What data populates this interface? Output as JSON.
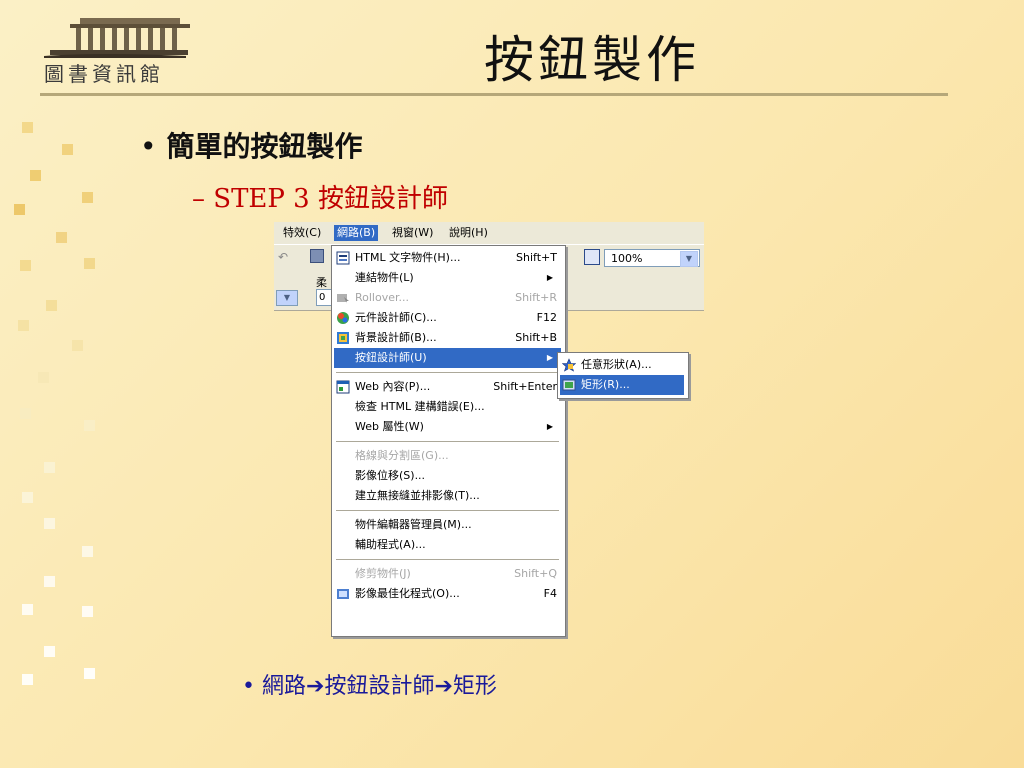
{
  "logo": {
    "caption": "圖書資訊館"
  },
  "slide": {
    "title": "按鈕製作",
    "bullet1": "簡單的按鈕製作",
    "bullet1_marker": "•",
    "bullet2": "– STEP  3  按鈕設計師",
    "bullet3_marker": "•",
    "bullet3_parts": [
      "網路",
      "按鈕設計師",
      "矩形"
    ],
    "arrow_glyph": "➔"
  },
  "app": {
    "menubar": [
      {
        "label": "特效(C)"
      },
      {
        "label": "網路(B)",
        "active": true
      },
      {
        "label": "視窗(W)"
      },
      {
        "label": "說明(H)"
      }
    ],
    "toolbar": {
      "zoom_value": "100%",
      "partial_label": "柔",
      "partial_value": "0"
    },
    "network_menu": [
      {
        "label": "HTML 文字物件(H)...",
        "shortcut": "Shift+T",
        "icon": "html-text-icon"
      },
      {
        "label": "連結物件(L)",
        "submenu": true
      },
      {
        "label": "Rollover...",
        "shortcut": "Shift+R",
        "disabled": true,
        "icon": "rollover-icon"
      },
      {
        "label": "元件設計師(C)...",
        "shortcut": "F12",
        "icon": "component-designer-icon"
      },
      {
        "label": "背景設計師(B)...",
        "shortcut": "Shift+B",
        "icon": "background-designer-icon"
      },
      {
        "label": "按鈕設計師(U)",
        "submenu": true,
        "highlighted": true
      },
      {
        "separator": true
      },
      {
        "label": "Web 內容(P)...",
        "shortcut": "Shift+Enter",
        "icon": "web-content-icon"
      },
      {
        "label": "檢查 HTML 建構錯誤(E)..."
      },
      {
        "label": "Web 屬性(W)",
        "submenu": true
      },
      {
        "separator": true
      },
      {
        "label": "格線與分割區(G)...",
        "disabled": true
      },
      {
        "label": "影像位移(S)..."
      },
      {
        "label": "建立無接縫並排影像(T)..."
      },
      {
        "separator": true
      },
      {
        "label": "物件編輯器管理員(M)..."
      },
      {
        "label": "輔助程式(A)..."
      },
      {
        "separator": true
      },
      {
        "label": "修剪物件(J)",
        "shortcut": "Shift+Q",
        "disabled": true
      },
      {
        "label": "影像最佳化程式(O)...",
        "shortcut": "F4",
        "icon": "image-optimizer-icon"
      }
    ],
    "button_submenu": [
      {
        "label": "任意形狀(A)...",
        "icon": "star-shape-icon"
      },
      {
        "label": "矩形(R)...",
        "icon": "rectangle-button-icon",
        "highlighted": true
      }
    ]
  },
  "colors": {
    "selection": "#316ac5",
    "step_red": "#c00000",
    "sub_blue": "#1a1a9a",
    "bg": "#fbe7ae"
  }
}
